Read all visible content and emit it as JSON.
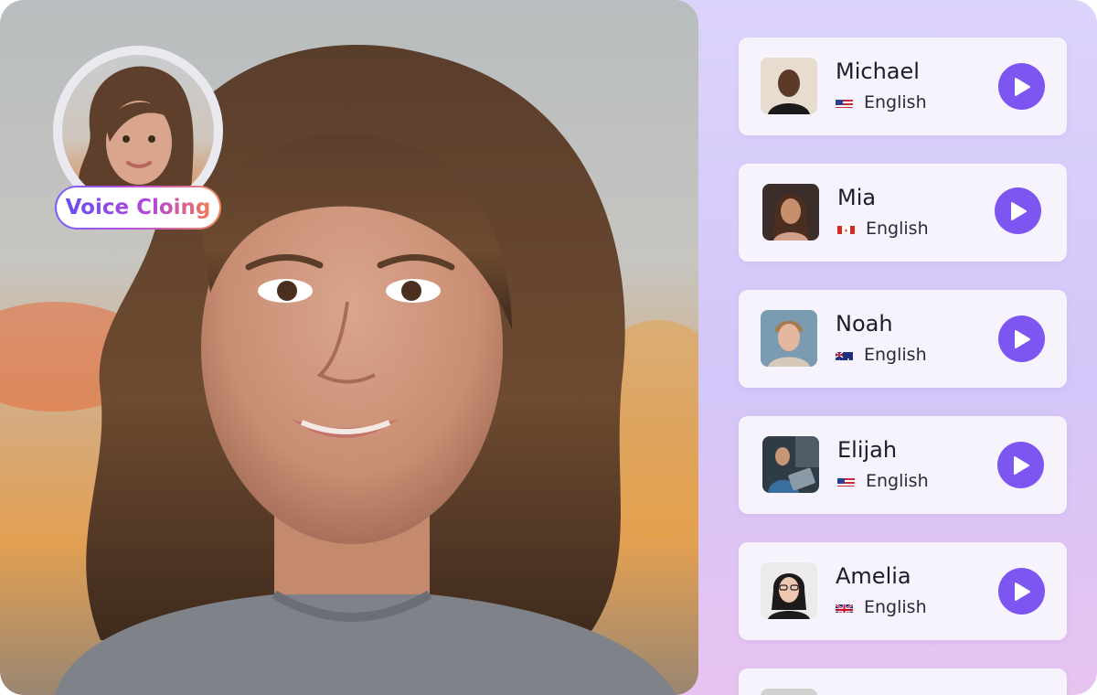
{
  "badge": {
    "label": "Voice Cloing"
  },
  "voices": [
    {
      "name": "Michael",
      "language": "English",
      "flag": "us-flag-icon"
    },
    {
      "name": "Mia",
      "language": "English",
      "flag": "ca-flag-icon"
    },
    {
      "name": "Noah",
      "language": "English",
      "flag": "au-flag-icon"
    },
    {
      "name": "Elijah",
      "language": "English",
      "flag": "us-flag-icon"
    },
    {
      "name": "Amelia",
      "language": "English",
      "flag": "uk-flag-icon"
    }
  ],
  "colors": {
    "accent": "#7d55f1",
    "panel_bg": "#d6cbf9",
    "card_bg": "#f6f3fd",
    "badge_gradient_start": "#6a4ff0",
    "badge_gradient_end": "#ee7b56"
  }
}
